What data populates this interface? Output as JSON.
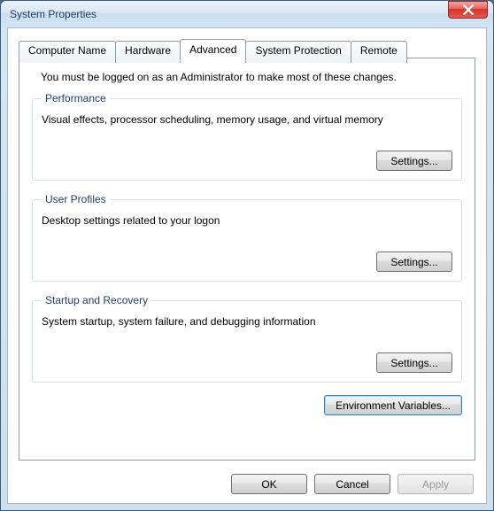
{
  "window": {
    "title": "System Properties"
  },
  "tabs": {
    "computer_name": "Computer Name",
    "hardware": "Hardware",
    "advanced": "Advanced",
    "system_protection": "System Protection",
    "remote": "Remote"
  },
  "intro": "You must be logged on as an Administrator to make most of these changes.",
  "groups": {
    "performance": {
      "legend": "Performance",
      "desc": "Visual effects, processor scheduling, memory usage, and virtual memory",
      "button": "Settings..."
    },
    "user_profiles": {
      "legend": "User Profiles",
      "desc": "Desktop settings related to your logon",
      "button": "Settings..."
    },
    "startup_recovery": {
      "legend": "Startup and Recovery",
      "desc": "System startup, system failure, and debugging information",
      "button": "Settings..."
    }
  },
  "buttons": {
    "env": "Environment Variables...",
    "ok": "OK",
    "cancel": "Cancel",
    "apply": "Apply"
  }
}
